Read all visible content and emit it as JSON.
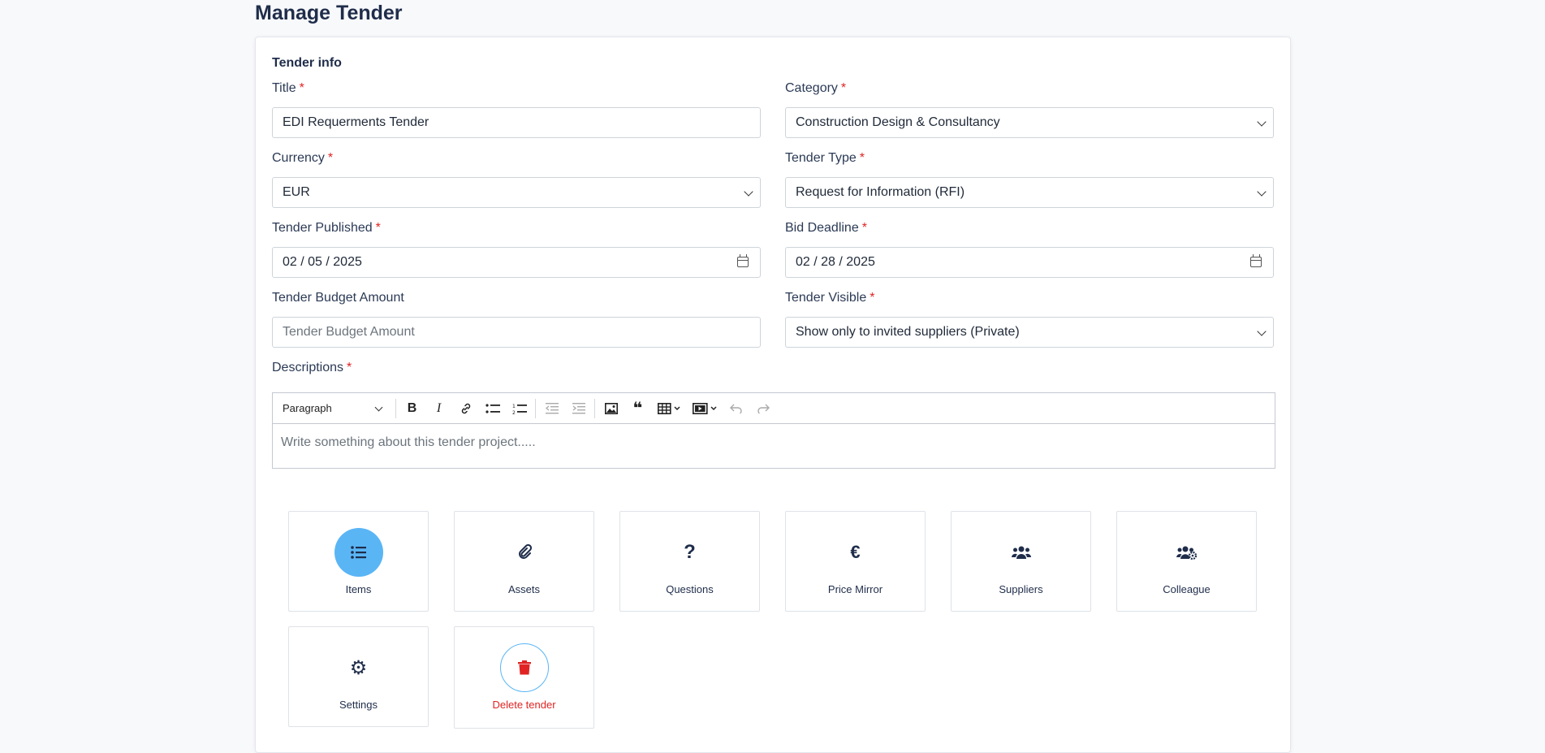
{
  "page": {
    "title": "Manage Tender"
  },
  "section": {
    "title": "Tender info"
  },
  "form": {
    "title": {
      "label": "Title",
      "value": "EDI Requerments Tender"
    },
    "category": {
      "label": "Category",
      "value": "Construction Design & Consultancy"
    },
    "currency": {
      "label": "Currency",
      "value": "EUR"
    },
    "tender_type": {
      "label": "Tender Type",
      "value": "Request for Information (RFI)"
    },
    "published": {
      "label": "Tender Published",
      "value": "02 / 05 / 2025"
    },
    "deadline": {
      "label": "Bid Deadline",
      "value": "02 / 28 / 2025"
    },
    "budget": {
      "label": "Tender Budget Amount",
      "placeholder": "Tender Budget Amount"
    },
    "visible": {
      "label": "Tender Visible",
      "value": "Show only to invited suppliers (Private)"
    },
    "descriptions": {
      "label": "Descriptions",
      "placeholder": "Write something about this tender project....."
    },
    "required_mark": "*"
  },
  "editor": {
    "paragraph_label": "Paragraph",
    "tools": [
      "bold-icon",
      "italic-icon",
      "link-icon",
      "bulleted-list-icon",
      "numbered-list-icon",
      "outdent-icon",
      "indent-icon",
      "image-icon",
      "quote-icon",
      "table-icon",
      "media-icon",
      "undo-icon",
      "redo-icon"
    ]
  },
  "tiles": [
    {
      "label": "Items",
      "icon": "list-icon",
      "glyph": "☰"
    },
    {
      "label": "Assets",
      "icon": "paperclip-icon",
      "glyph": "📎"
    },
    {
      "label": "Questions",
      "icon": "question-icon",
      "glyph": "?"
    },
    {
      "label": "Price Mirror",
      "icon": "euro-icon",
      "glyph": "€"
    },
    {
      "label": "Suppliers",
      "icon": "users-icon",
      "glyph": "👥"
    },
    {
      "label": "Colleague",
      "icon": "users-cog-icon",
      "glyph": "👥"
    },
    {
      "label": "Settings",
      "icon": "gear-icon",
      "glyph": "⚙"
    },
    {
      "label": "Delete tender",
      "icon": "trash-icon",
      "glyph": "🗑"
    }
  ],
  "colors": {
    "accent": "#5ab5f5",
    "danger": "#e02424",
    "text": "#1f2d4a"
  }
}
